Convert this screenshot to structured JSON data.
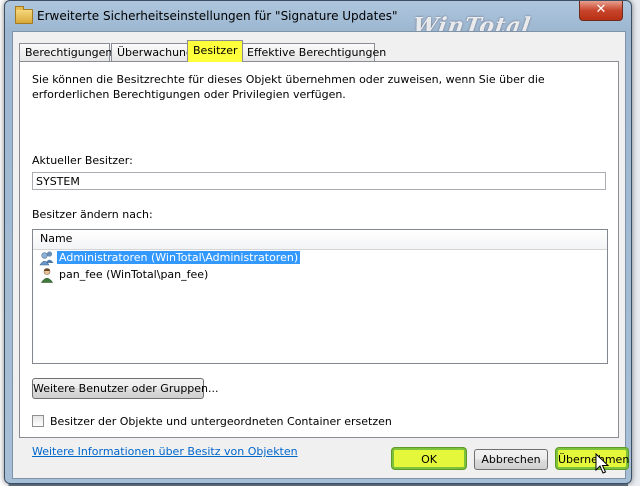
{
  "window": {
    "title": "Erweiterte Sicherheitseinstellungen für \"Signature Updates\"",
    "watermark": "WinTotal",
    "close_label": "✕"
  },
  "tabs": [
    {
      "label": "Berechtigungen",
      "active": false
    },
    {
      "label": "Überwachung",
      "active": false
    },
    {
      "label": "Besitzer",
      "active": true
    },
    {
      "label": "Effektive Berechtigungen",
      "active": false
    }
  ],
  "owner": {
    "description": "Sie können die Besitzrechte für dieses Objekt übernehmen oder zuweisen, wenn Sie über die erforderlichen Berechtigungen oder Privilegien verfügen.",
    "current_owner_label": "Aktueller Besitzer:",
    "current_owner_value": "SYSTEM",
    "change_owner_label": "Besitzer ändern nach:",
    "list_column": "Name",
    "list_items": [
      {
        "name": "Administratoren (WinTotal\\Administratoren)",
        "icon": "user-group-icon",
        "selected": true
      },
      {
        "name": "pan_fee (WinTotal\\pan_fee)",
        "icon": "user-icon",
        "selected": false
      }
    ],
    "more_users_button": "Weitere Benutzer oder Gruppen...",
    "replace_checkbox_label": "Besitzer der Objekte und untergeordneten Container ersetzen",
    "replace_checked": false,
    "info_link": "Weitere Informationen über Besitz von Objekten"
  },
  "buttons": {
    "ok": "OK",
    "cancel": "Abbrechen",
    "apply": "Übernehmen"
  },
  "colors": {
    "highlight_yellow": "#ffff3c",
    "selection_blue": "#3399ff",
    "link_blue": "#0066cc"
  }
}
